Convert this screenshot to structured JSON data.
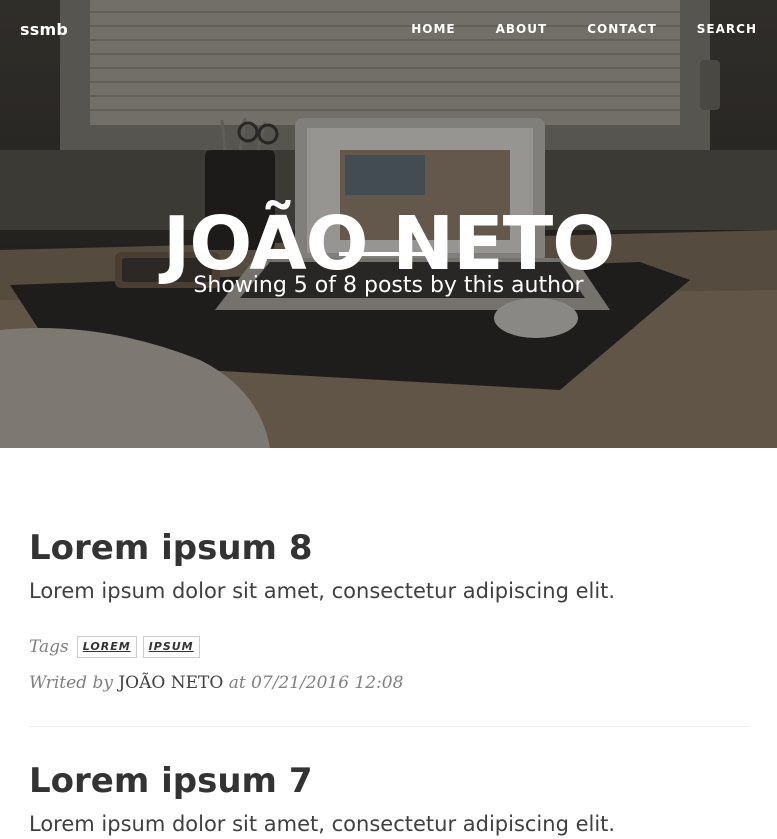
{
  "header": {
    "brand": "ssmb",
    "nav": [
      "HOME",
      "ABOUT",
      "CONTACT",
      "SEARCH"
    ]
  },
  "hero": {
    "title": "JOÃO NETO",
    "subtitle": "Showing 5 of 8 posts by this author"
  },
  "posts": [
    {
      "title": "Lorem ipsum 8",
      "excerpt": "Lorem ipsum dolor sit amet, consectetur adipiscing elit.",
      "tags_label": "Tags",
      "tags": [
        "LOREM",
        "IPSUM"
      ],
      "written_by_label": "Writed by",
      "author": "JOÃO NETO",
      "at_label": "at",
      "date": "07/21/2016 12:08"
    },
    {
      "title": "Lorem ipsum 7",
      "excerpt": "Lorem ipsum dolor sit amet, consectetur adipiscing elit."
    }
  ]
}
